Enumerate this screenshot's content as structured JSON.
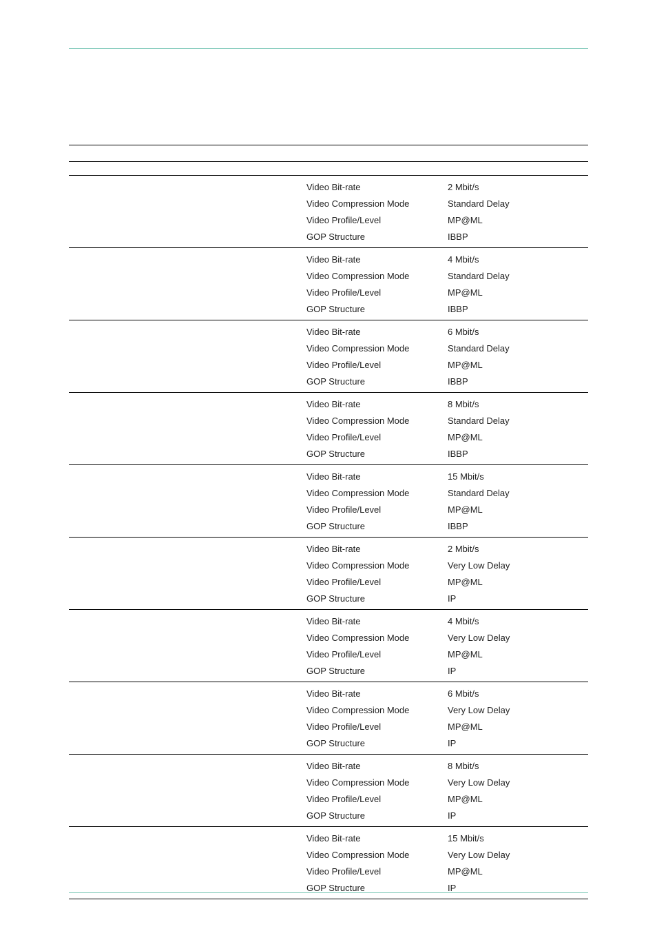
{
  "labels": {
    "bitrate": "Video Bit-rate",
    "mode": "Video Compression Mode",
    "profile": "Video Profile/Level",
    "gop": "GOP Structure"
  },
  "groups": [
    {
      "bitrate": "2 Mbit/s",
      "mode": "Standard Delay",
      "profile": "MP@ML",
      "gop": "IBBP"
    },
    {
      "bitrate": "4 Mbit/s",
      "mode": "Standard Delay",
      "profile": "MP@ML",
      "gop": "IBBP"
    },
    {
      "bitrate": "6 Mbit/s",
      "mode": "Standard Delay",
      "profile": "MP@ML",
      "gop": "IBBP"
    },
    {
      "bitrate": "8 Mbit/s",
      "mode": "Standard Delay",
      "profile": "MP@ML",
      "gop": "IBBP"
    },
    {
      "bitrate": "15 Mbit/s",
      "mode": "Standard Delay",
      "profile": "MP@ML",
      "gop": "IBBP"
    },
    {
      "bitrate": "2 Mbit/s",
      "mode": "Very Low Delay",
      "profile": "MP@ML",
      "gop": "IP"
    },
    {
      "bitrate": "4 Mbit/s",
      "mode": "Very Low Delay",
      "profile": "MP@ML",
      "gop": "IP"
    },
    {
      "bitrate": "6 Mbit/s",
      "mode": "Very Low Delay",
      "profile": "MP@ML",
      "gop": "IP"
    },
    {
      "bitrate": "8 Mbit/s",
      "mode": "Very Low Delay",
      "profile": "MP@ML",
      "gop": "IP"
    },
    {
      "bitrate": "15 Mbit/s",
      "mode": "Very Low Delay",
      "profile": "MP@ML",
      "gop": "IP"
    }
  ]
}
